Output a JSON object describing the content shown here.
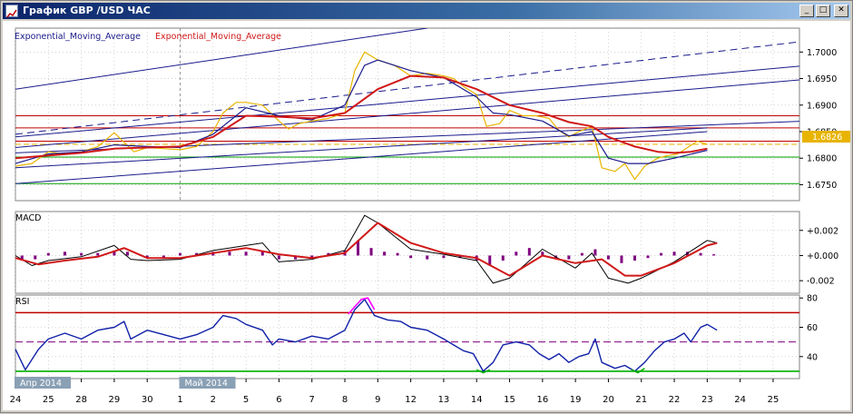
{
  "window": {
    "title": "График GBP /USD  ЧАС",
    "buttons": {
      "minimize": "_",
      "maximize": "□",
      "close": "✕"
    }
  },
  "colors": {
    "price": "#e8b400",
    "ema_slow": "#1a1a8c",
    "ema_fast": "#d01818",
    "macd_hist": "#800080",
    "rsi_line": "#1020a8",
    "rsi_high": "#ff00ff",
    "rsi_low": "#00b000",
    "level_red": "#c00000",
    "level_green": "#00a000",
    "trend": "#1a1a8c",
    "price_label_bg": "#e8b400"
  },
  "chart_data": [
    {
      "type": "line",
      "name": "price-panel",
      "legend": [
        "Exponential_Moving_Average",
        "Exponential_Moving_Average"
      ],
      "ylim": [
        1.672,
        1.7045
      ],
      "yticks": [
        "1.7000",
        "1.6950",
        "1.6900",
        "1.6850",
        "1.6800",
        "1.6750"
      ],
      "ytick_values": [
        1.7,
        1.695,
        1.69,
        1.685,
        1.68,
        1.675
      ],
      "current_price": "1.6826",
      "current_price_value": 1.6826,
      "horizontal_levels": {
        "red": [
          1.688,
          1.6857,
          1.6832
        ],
        "green": [
          1.6802,
          1.6752
        ]
      },
      "x_index_range": [
        0,
        22
      ],
      "price_series": [
        [
          0,
          1.6785
        ],
        [
          0.5,
          1.679
        ],
        [
          1,
          1.6812
        ],
        [
          1.5,
          1.6808
        ],
        [
          2,
          1.6812
        ],
        [
          2.5,
          1.6822
        ],
        [
          3,
          1.6848
        ],
        [
          3.3,
          1.683
        ],
        [
          3.6,
          1.6812
        ],
        [
          4,
          1.682
        ],
        [
          4.5,
          1.6818
        ],
        [
          5,
          1.6816
        ],
        [
          5.5,
          1.6822
        ],
        [
          6,
          1.685
        ],
        [
          6.3,
          1.6885
        ],
        [
          6.7,
          1.6905
        ],
        [
          7,
          1.6905
        ],
        [
          7.5,
          1.69
        ],
        [
          8,
          1.687
        ],
        [
          8.3,
          1.6855
        ],
        [
          8.6,
          1.6865
        ],
        [
          9,
          1.687
        ],
        [
          9.5,
          1.6875
        ],
        [
          10,
          1.6885
        ],
        [
          10.3,
          1.6965
        ],
        [
          10.6,
          1.7
        ],
        [
          11,
          1.6985
        ],
        [
          11.5,
          1.6975
        ],
        [
          12,
          1.6955
        ],
        [
          12.5,
          1.696
        ],
        [
          13,
          1.6955
        ],
        [
          13.3,
          1.695
        ],
        [
          13.6,
          1.6935
        ],
        [
          14,
          1.692
        ],
        [
          14.3,
          1.686
        ],
        [
          14.7,
          1.6865
        ],
        [
          15,
          1.689
        ],
        [
          15.4,
          1.688
        ],
        [
          15.8,
          1.688
        ],
        [
          16.2,
          1.6875
        ],
        [
          16.5,
          1.6852
        ],
        [
          16.8,
          1.684
        ],
        [
          17.1,
          1.685
        ],
        [
          17.5,
          1.686
        ],
        [
          17.8,
          1.6782
        ],
        [
          18.2,
          1.6775
        ],
        [
          18.5,
          1.679
        ],
        [
          18.8,
          1.676
        ],
        [
          19.1,
          1.6785
        ],
        [
          19.5,
          1.68
        ],
        [
          19.8,
          1.6805
        ],
        [
          20.1,
          1.6808
        ],
        [
          20.4,
          1.682
        ],
        [
          20.7,
          1.6832
        ],
        [
          21,
          1.6826
        ]
      ],
      "ema_slow_series": [
        [
          0,
          1.679
        ],
        [
          1,
          1.6808
        ],
        [
          2,
          1.6812
        ],
        [
          3,
          1.6825
        ],
        [
          4,
          1.6822
        ],
        [
          5,
          1.682
        ],
        [
          6,
          1.6845
        ],
        [
          7,
          1.6895
        ],
        [
          8,
          1.688
        ],
        [
          9,
          1.6872
        ],
        [
          10,
          1.69
        ],
        [
          10.6,
          1.6975
        ],
        [
          11,
          1.6985
        ],
        [
          12,
          1.6965
        ],
        [
          13,
          1.6952
        ],
        [
          14,
          1.6915
        ],
        [
          14.5,
          1.6885
        ],
        [
          15,
          1.6882
        ],
        [
          16,
          1.687
        ],
        [
          16.8,
          1.6842
        ],
        [
          17.5,
          1.685
        ],
        [
          18,
          1.68
        ],
        [
          18.6,
          1.679
        ],
        [
          19.2,
          1.679
        ],
        [
          20,
          1.68
        ],
        [
          21,
          1.6815
        ]
      ],
      "ema_fast_series": [
        [
          0,
          1.68
        ],
        [
          1,
          1.6805
        ],
        [
          2,
          1.681
        ],
        [
          3,
          1.6818
        ],
        [
          4,
          1.682
        ],
        [
          5,
          1.6822
        ],
        [
          6,
          1.684
        ],
        [
          7,
          1.688
        ],
        [
          8,
          1.6878
        ],
        [
          9,
          1.6875
        ],
        [
          10,
          1.6885
        ],
        [
          11,
          1.693
        ],
        [
          12,
          1.6955
        ],
        [
          13,
          1.6952
        ],
        [
          14,
          1.693
        ],
        [
          15,
          1.69
        ],
        [
          16,
          1.6885
        ],
        [
          16.8,
          1.6868
        ],
        [
          17.5,
          1.686
        ],
        [
          18,
          1.684
        ],
        [
          18.8,
          1.6822
        ],
        [
          19.5,
          1.6812
        ],
        [
          20,
          1.681
        ],
        [
          20.5,
          1.6812
        ],
        [
          21,
          1.6818
        ]
      ],
      "trend_lines": [
        [
          [
            0,
            1.6782
          ],
          [
            21,
            1.6857
          ]
        ],
        [
          [
            0,
            1.6752
          ],
          [
            21,
            1.685
          ]
        ],
        [
          [
            0,
            1.681
          ],
          [
            28,
            1.688
          ]
        ],
        [
          [
            0,
            1.693
          ],
          [
            12.5,
            1.7045
          ]
        ],
        [
          [
            0,
            1.682
          ],
          [
            28,
            1.697
          ]
        ],
        [
          [
            0,
            1.684
          ],
          [
            28,
            1.6997
          ]
        ]
      ],
      "trend_dashed": [
        [
          [
            0,
            1.6845
          ],
          [
            28,
            1.705
          ]
        ]
      ]
    },
    {
      "type": "bar",
      "name": "MACD",
      "title": "MACD",
      "ylim": [
        -0.003,
        0.0035
      ],
      "yticks": [
        "+0.002",
        "+0.000",
        "-0.002"
      ],
      "ytick_values": [
        0.002,
        0.0,
        -0.002
      ],
      "macd_line": [
        [
          0,
          0
        ],
        [
          0.5,
          -0.0008
        ],
        [
          1,
          -0.0004
        ],
        [
          2,
          -0.0001
        ],
        [
          3,
          0.0008
        ],
        [
          3.5,
          -0.0003
        ],
        [
          4,
          -0.0004
        ],
        [
          5,
          -0.0003
        ],
        [
          6,
          0.0004
        ],
        [
          7,
          0.0008
        ],
        [
          7.5,
          0.001
        ],
        [
          8,
          -0.0005
        ],
        [
          9,
          -0.0003
        ],
        [
          10,
          0.0004
        ],
        [
          10.6,
          0.0032
        ],
        [
          11,
          0.0026
        ],
        [
          12,
          0.0005
        ],
        [
          13,
          0.0001
        ],
        [
          14,
          -0.0004
        ],
        [
          14.5,
          -0.0022
        ],
        [
          15,
          -0.0018
        ],
        [
          16,
          0.0005
        ],
        [
          17,
          -0.001
        ],
        [
          17.5,
          0.0002
        ],
        [
          18,
          -0.0018
        ],
        [
          18.6,
          -0.0022
        ],
        [
          19,
          -0.0018
        ],
        [
          20,
          -0.0005
        ],
        [
          21,
          0.0012
        ],
        [
          21.3,
          0.001
        ]
      ],
      "signal_line": [
        [
          0,
          -0.0002
        ],
        [
          0.7,
          -0.0007
        ],
        [
          1.5,
          -0.0004
        ],
        [
          2.5,
          -0.0001
        ],
        [
          3.3,
          0.0006
        ],
        [
          4,
          -0.0002
        ],
        [
          5,
          -0.0002
        ],
        [
          6,
          0.0002
        ],
        [
          7,
          0.0006
        ],
        [
          8,
          0.0001
        ],
        [
          9,
          -0.0002
        ],
        [
          10,
          0.0002
        ],
        [
          11,
          0.0026
        ],
        [
          12,
          0.001
        ],
        [
          13,
          0.0002
        ],
        [
          14,
          -0.0002
        ],
        [
          15,
          -0.0016
        ],
        [
          16,
          0.0
        ],
        [
          17,
          -0.0006
        ],
        [
          17.8,
          -0.0003
        ],
        [
          18.5,
          -0.0016
        ],
        [
          19,
          -0.0016
        ],
        [
          20,
          -0.0006
        ],
        [
          21,
          0.0008
        ],
        [
          21.3,
          0.001
        ]
      ],
      "histogram": [
        [
          0.2,
          -0.0004
        ],
        [
          0.6,
          -0.0003
        ],
        [
          1,
          0.0002
        ],
        [
          1.5,
          0.0003
        ],
        [
          2,
          0.0002
        ],
        [
          2.5,
          0.0002
        ],
        [
          3,
          0.0004
        ],
        [
          3.4,
          0.0003
        ],
        [
          4,
          -0.0002
        ],
        [
          4.5,
          -0.0002
        ],
        [
          5,
          0.0002
        ],
        [
          5.5,
          0.0002
        ],
        [
          6,
          0.0003
        ],
        [
          6.5,
          0.0003
        ],
        [
          7,
          0.0003
        ],
        [
          7.5,
          0.0003
        ],
        [
          8,
          -0.0003
        ],
        [
          8.5,
          -0.0003
        ],
        [
          9,
          -0.0002
        ],
        [
          9.5,
          0.0002
        ],
        [
          10,
          0.0004
        ],
        [
          10.4,
          0.0012
        ],
        [
          10.8,
          0.0006
        ],
        [
          11.2,
          0.0003
        ],
        [
          11.6,
          0.0002
        ],
        [
          12,
          -0.0002
        ],
        [
          12.5,
          -0.0003
        ],
        [
          13,
          -0.0002
        ],
        [
          13.5,
          -0.0002
        ],
        [
          14,
          -0.0004
        ],
        [
          14.4,
          -0.0008
        ],
        [
          14.8,
          -0.0004
        ],
        [
          15.2,
          0.0003
        ],
        [
          15.6,
          0.0006
        ],
        [
          16,
          0.0003
        ],
        [
          16.4,
          -0.0002
        ],
        [
          16.8,
          -0.0003
        ],
        [
          17.2,
          0.0002
        ],
        [
          17.6,
          0.0005
        ],
        [
          18,
          -0.0003
        ],
        [
          18.4,
          -0.0006
        ],
        [
          18.8,
          -0.0004
        ],
        [
          19.2,
          -0.0002
        ],
        [
          19.6,
          0.0002
        ],
        [
          20,
          0.0003
        ],
        [
          20.4,
          0.0003
        ],
        [
          20.8,
          0.0002
        ],
        [
          21.2,
          0.0001
        ]
      ]
    },
    {
      "type": "line",
      "name": "RSI",
      "title": "RSI",
      "ylim": [
        25,
        82
      ],
      "yticks": [
        "80",
        "60",
        "40"
      ],
      "ytick_values": [
        80,
        60,
        40
      ],
      "levels": {
        "upper": 70,
        "middle": 50,
        "lower": 30
      },
      "series": [
        [
          0,
          45
        ],
        [
          0.3,
          31
        ],
        [
          0.7,
          45
        ],
        [
          1,
          52
        ],
        [
          1.5,
          56
        ],
        [
          2,
          52
        ],
        [
          2.5,
          58
        ],
        [
          3,
          60
        ],
        [
          3.3,
          64
        ],
        [
          3.5,
          52
        ],
        [
          4,
          58
        ],
        [
          4.5,
          55
        ],
        [
          5,
          52
        ],
        [
          5.5,
          55
        ],
        [
          6,
          60
        ],
        [
          6.3,
          68
        ],
        [
          6.7,
          66
        ],
        [
          7,
          62
        ],
        [
          7.5,
          58
        ],
        [
          7.8,
          48
        ],
        [
          8,
          52
        ],
        [
          8.5,
          50
        ],
        [
          9,
          54
        ],
        [
          9.5,
          52
        ],
        [
          10,
          58
        ],
        [
          10.3,
          72
        ],
        [
          10.6,
          79
        ],
        [
          10.9,
          68
        ],
        [
          11.3,
          65
        ],
        [
          11.7,
          64
        ],
        [
          12,
          60
        ],
        [
          12.5,
          58
        ],
        [
          13,
          52
        ],
        [
          13.3,
          48
        ],
        [
          13.6,
          44
        ],
        [
          13.9,
          42
        ],
        [
          14.2,
          30
        ],
        [
          14.5,
          36
        ],
        [
          14.8,
          48
        ],
        [
          15.2,
          50
        ],
        [
          15.6,
          48
        ],
        [
          15.9,
          42
        ],
        [
          16.2,
          38
        ],
        [
          16.5,
          42
        ],
        [
          16.8,
          36
        ],
        [
          17.1,
          40
        ],
        [
          17.4,
          42
        ],
        [
          17.6,
          52
        ],
        [
          17.8,
          36
        ],
        [
          18.2,
          32
        ],
        [
          18.5,
          34
        ],
        [
          18.8,
          30
        ],
        [
          19.1,
          36
        ],
        [
          19.4,
          44
        ],
        [
          19.7,
          50
        ],
        [
          20,
          52
        ],
        [
          20.3,
          56
        ],
        [
          20.5,
          50
        ],
        [
          20.8,
          60
        ],
        [
          21,
          62
        ],
        [
          21.3,
          58
        ]
      ],
      "overbought_segment": [
        [
          10.1,
          69
        ],
        [
          10.3,
          74
        ],
        [
          10.5,
          79
        ],
        [
          10.7,
          80
        ],
        [
          10.9,
          72
        ]
      ],
      "oversold_segments": [
        [
          [
            14.0,
            31
          ],
          [
            14.2,
            29
          ],
          [
            14.4,
            31
          ]
        ],
        [
          [
            18.7,
            31
          ],
          [
            18.9,
            29
          ],
          [
            19.1,
            32
          ]
        ]
      ]
    }
  ],
  "x_axis": {
    "labels": [
      {
        "text": "24",
        "i": 0
      },
      {
        "text": "25",
        "i": 1
      },
      {
        "text": "28",
        "i": 2
      },
      {
        "text": "29",
        "i": 3
      },
      {
        "text": "30",
        "i": 4
      },
      {
        "text": "1",
        "i": 5
      },
      {
        "text": "2",
        "i": 6
      },
      {
        "text": "5",
        "i": 7
      },
      {
        "text": "6",
        "i": 8
      },
      {
        "text": "7",
        "i": 9
      },
      {
        "text": "8",
        "i": 10
      },
      {
        "text": "9",
        "i": 11
      },
      {
        "text": "12",
        "i": 12
      },
      {
        "text": "13",
        "i": 13
      },
      {
        "text": "14",
        "i": 14
      },
      {
        "text": "15",
        "i": 15
      },
      {
        "text": "16",
        "i": 16
      },
      {
        "text": "19",
        "i": 17
      },
      {
        "text": "20",
        "i": 18
      },
      {
        "text": "21",
        "i": 19
      },
      {
        "text": "22",
        "i": 20
      },
      {
        "text": "23",
        "i": 21
      },
      {
        "text": "24",
        "i": 22
      },
      {
        "text": "25",
        "i": 23
      }
    ],
    "month_markers": [
      {
        "text": "Апр 2014",
        "i": 0
      },
      {
        "text": "Май 2014",
        "i": 5
      }
    ]
  }
}
